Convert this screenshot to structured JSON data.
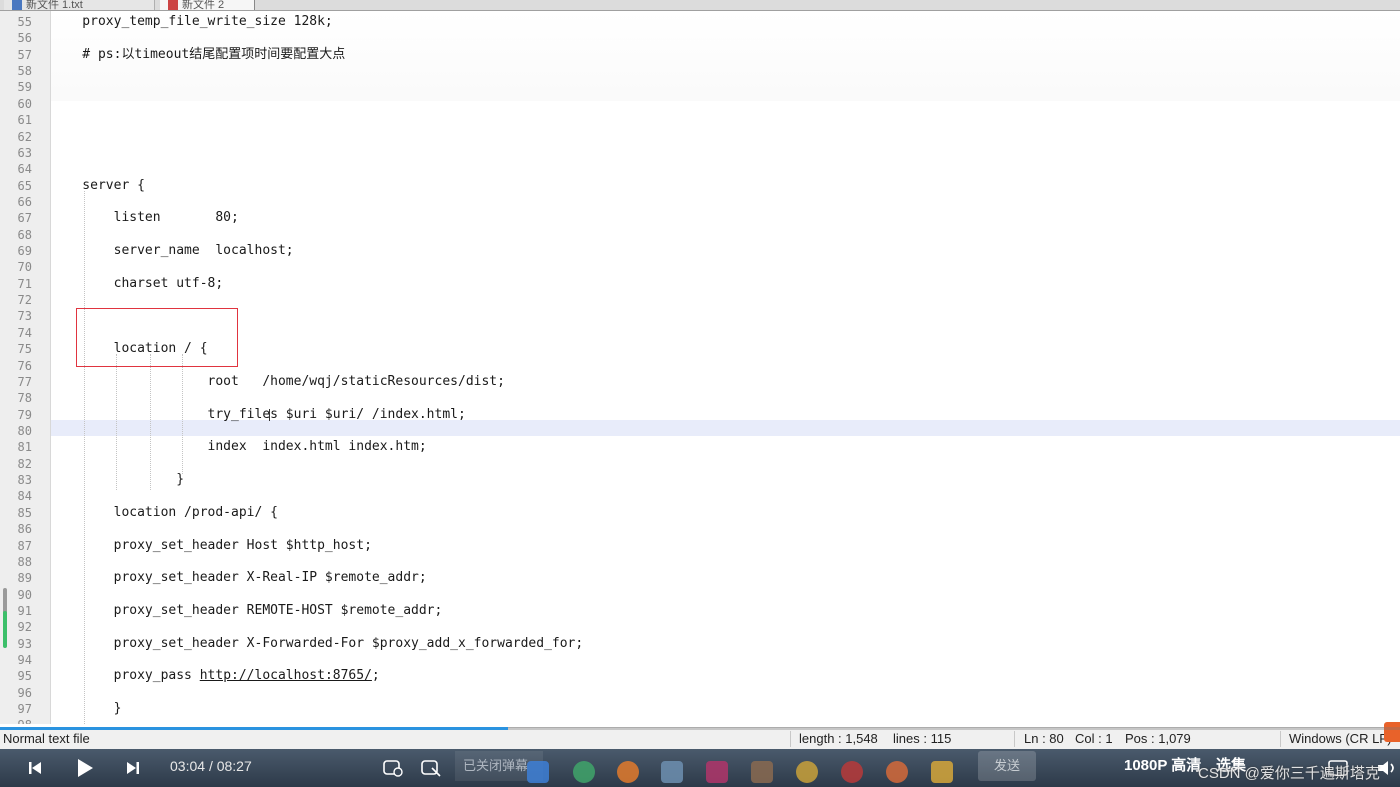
{
  "tabs": [
    {
      "label": "新文件 1.txt"
    },
    {
      "label": "新文件 2"
    }
  ],
  "editor": {
    "lines": [
      {
        "no": "55",
        "text": "    proxy_temp_file_write_size 128k;"
      },
      {
        "no": "56",
        "text": ""
      },
      {
        "no": "57",
        "text": "    # ps:以timeout结尾配置项时间要配置大点"
      },
      {
        "no": "58",
        "text": ""
      },
      {
        "no": "59",
        "text": ""
      },
      {
        "no": "60",
        "text": ""
      },
      {
        "no": "61",
        "text": ""
      },
      {
        "no": "62",
        "text": ""
      },
      {
        "no": "63",
        "text": ""
      },
      {
        "no": "64",
        "text": ""
      },
      {
        "no": "65",
        "text": "    server {"
      },
      {
        "no": "66",
        "text": ""
      },
      {
        "no": "67",
        "text": "        listen       80;"
      },
      {
        "no": "68",
        "text": ""
      },
      {
        "no": "69",
        "text": "        server_name  localhost;"
      },
      {
        "no": "70",
        "text": ""
      },
      {
        "no": "71",
        "text": "        charset utf-8;"
      },
      {
        "no": "72",
        "text": ""
      },
      {
        "no": "73",
        "text": ""
      },
      {
        "no": "74",
        "text": ""
      },
      {
        "no": "75",
        "text": "        location / {"
      },
      {
        "no": "76",
        "text": ""
      },
      {
        "no": "77",
        "text": "                    root   /home/wqj/staticResources/dist;"
      },
      {
        "no": "78",
        "text": ""
      },
      {
        "no": "79",
        "text": "                    try_files $uri $uri/ /index.html;"
      },
      {
        "no": "80",
        "text": ""
      },
      {
        "no": "81",
        "text": "                    index  index.html index.htm;"
      },
      {
        "no": "82",
        "text": ""
      },
      {
        "no": "83",
        "text": "                }"
      },
      {
        "no": "84",
        "text": ""
      },
      {
        "no": "85",
        "text": "        location /prod-api/ {"
      },
      {
        "no": "86",
        "text": ""
      },
      {
        "no": "87",
        "text": "        proxy_set_header Host $http_host;"
      },
      {
        "no": "88",
        "text": ""
      },
      {
        "no": "89",
        "text": "        proxy_set_header X-Real-IP $remote_addr;"
      },
      {
        "no": "90",
        "text": ""
      },
      {
        "no": "91",
        "text": "        proxy_set_header REMOTE-HOST $remote_addr;"
      },
      {
        "no": "92",
        "text": ""
      },
      {
        "no": "93",
        "text": "        proxy_set_header X-Forwarded-For $proxy_add_x_forwarded_for;"
      },
      {
        "no": "94",
        "text": ""
      },
      {
        "no": "95",
        "text": "        proxy_pass ",
        "url": "http://localhost:8765/",
        "after": ";"
      },
      {
        "no": "96",
        "text": ""
      },
      {
        "no": "97",
        "text": "        }"
      },
      {
        "no": "98",
        "text": ""
      }
    ]
  },
  "status": {
    "file_type": "Normal text file",
    "length": "length : 1,548",
    "lines": "lines : 115",
    "ln": "Ln : 80",
    "col": "Col : 1",
    "pos": "Pos : 1,079",
    "eol": "Windows (CR LF)"
  },
  "player": {
    "current_time": "03:04",
    "separator": "/",
    "total_time": "08:27",
    "progress_fraction": 0.363,
    "danmu_placeholder": "已关闭弹幕",
    "send_label": "发送",
    "quality_label": "1080P 高清",
    "choose_label": "选集"
  },
  "watermark": "CSDN @爱你三千遍斯塔克",
  "colors": {
    "highlight_box": "#e0343f",
    "current_line": "#e8ecfa",
    "progress": "#2a93e0",
    "change_mark_saved": "#3cbf6a"
  },
  "icons": {
    "prev": "skip-previous-icon",
    "play": "play-icon",
    "next": "skip-next-icon",
    "danmu_settings": "danmu-settings-icon",
    "danmu_toggle": "danmu-toggle-icon",
    "volume": "volume-icon"
  }
}
